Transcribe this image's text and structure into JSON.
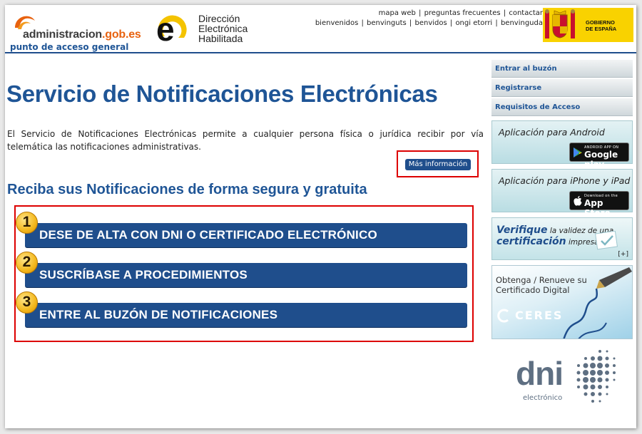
{
  "header": {
    "logo_main": "administracion",
    "logo_main_accent": ".gob.es",
    "logo_sub": "punto de acceso general",
    "deh_line1": "Dirección",
    "deh_line2": "Electrónica",
    "deh_line3": "Habilitada",
    "top_links_row1": [
      "mapa web",
      "preguntas frecuentes",
      "contactar"
    ],
    "top_links_row2": [
      "bienvenidos",
      "benvinguts",
      "benvidos",
      "ongi etorri",
      "benvinguda"
    ],
    "gob_line1": "GOBIERNO",
    "gob_line2": "DE ESPAÑA"
  },
  "main": {
    "title": "Servicio de Notificaciones Electrónicas",
    "intro": "El Servicio de Notificaciones Electrónicas permite a cualquier persona física o jurídica recibir por vía telemática las notificaciones administrativas.",
    "more_info_label": "Más información",
    "subtitle": "Reciba sus Notificaciones de forma segura y gratuita",
    "steps": [
      {
        "num": "1",
        "label": "DESE DE ALTA CON DNI O CERTIFICADO ELECTRÓNICO"
      },
      {
        "num": "2",
        "label": "SUSCRÍBASE A PROCEDIMIENTOS"
      },
      {
        "num": "3",
        "label": "ENTRE AL BUZÓN DE NOTIFICACIONES"
      }
    ]
  },
  "sidebar": {
    "nav": [
      "Entrar al buzón",
      "Registrarse",
      "Requisitos de Acceso"
    ],
    "android_title": "Aplicación para Android",
    "android_badge_small": "ANDROID APP ON",
    "android_badge_big": "Google play",
    "ios_title": "Aplicación para iPhone y iPad",
    "ios_badge_small": "Download on the",
    "ios_badge_big": "App Store",
    "verify_word1": "Verifique",
    "verify_mid": "la validez de una",
    "verify_word2": "certificación",
    "verify_end": "impresa",
    "verify_more": "[+]",
    "ceres_line1": "Obtenga / Renueve su",
    "ceres_line2": "Certificado Digital",
    "ceres_logo": "CERES",
    "dni_text": "dni",
    "dni_sub": "electrónico"
  }
}
